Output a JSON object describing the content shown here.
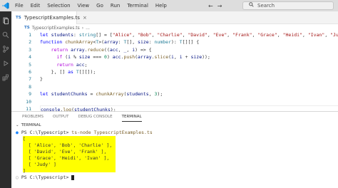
{
  "menu": [
    "File",
    "Edit",
    "Selection",
    "View",
    "Go",
    "Run",
    "Terminal",
    "Help"
  ],
  "search": {
    "placeholder": "Search"
  },
  "tab": {
    "label": "TypescriptExamples.ts",
    "badge": "TS"
  },
  "breadcrumb": {
    "file": "TypescriptExamples.ts",
    "scope": "..."
  },
  "editor": {
    "line_numbers": [
      "1",
      "2",
      "3",
      "4",
      "5",
      "6",
      "7",
      "8",
      "9",
      "10",
      "11"
    ],
    "lines": [
      "let students: string[] = [\"Alice\", \"Bob\", \"Charlie\", \"David\", \"Eve\", \"Frank\", \"Grace\", \"Heidi\", \"Ivan\", \"Judy\"];",
      "function chunkArray<T>(array: T[], size: number): T[][] {",
      "    return array.reduce((acc, _, i) => {",
      "      if (i % size === 0) acc.push(array.slice(i, i + size));",
      "      return acc;",
      "    }, [] as T[][]);",
      "}",
      "",
      "let studentChunks = chunkArray(students, 3);",
      "",
      "console.log(studentChunks);"
    ]
  },
  "panel": {
    "tabs": [
      "PROBLEMS",
      "OUTPUT",
      "DEBUG CONSOLE",
      "TERMINAL"
    ],
    "terminal_title": "TERMINAL"
  },
  "terminal": {
    "prompt": "PS C:\\Typescript>",
    "command": "ts-node TypescriptExamples.ts",
    "output": [
      "[",
      "  [ 'Alice', 'Bob', 'Charlie' ],",
      "  [ 'David', 'Eve', 'Frank' ],",
      "  [ 'Grace', 'Heidi', 'Ivan' ],",
      "  [ 'Judy' ]",
      "]"
    ],
    "final_prompt": "PS C:\\Typescript>"
  },
  "colors": {
    "highlight": "#ffff00",
    "activity_bar": "#2c2c2c",
    "titlebar": "#dddddd",
    "vscode_blue": "#007acc"
  }
}
